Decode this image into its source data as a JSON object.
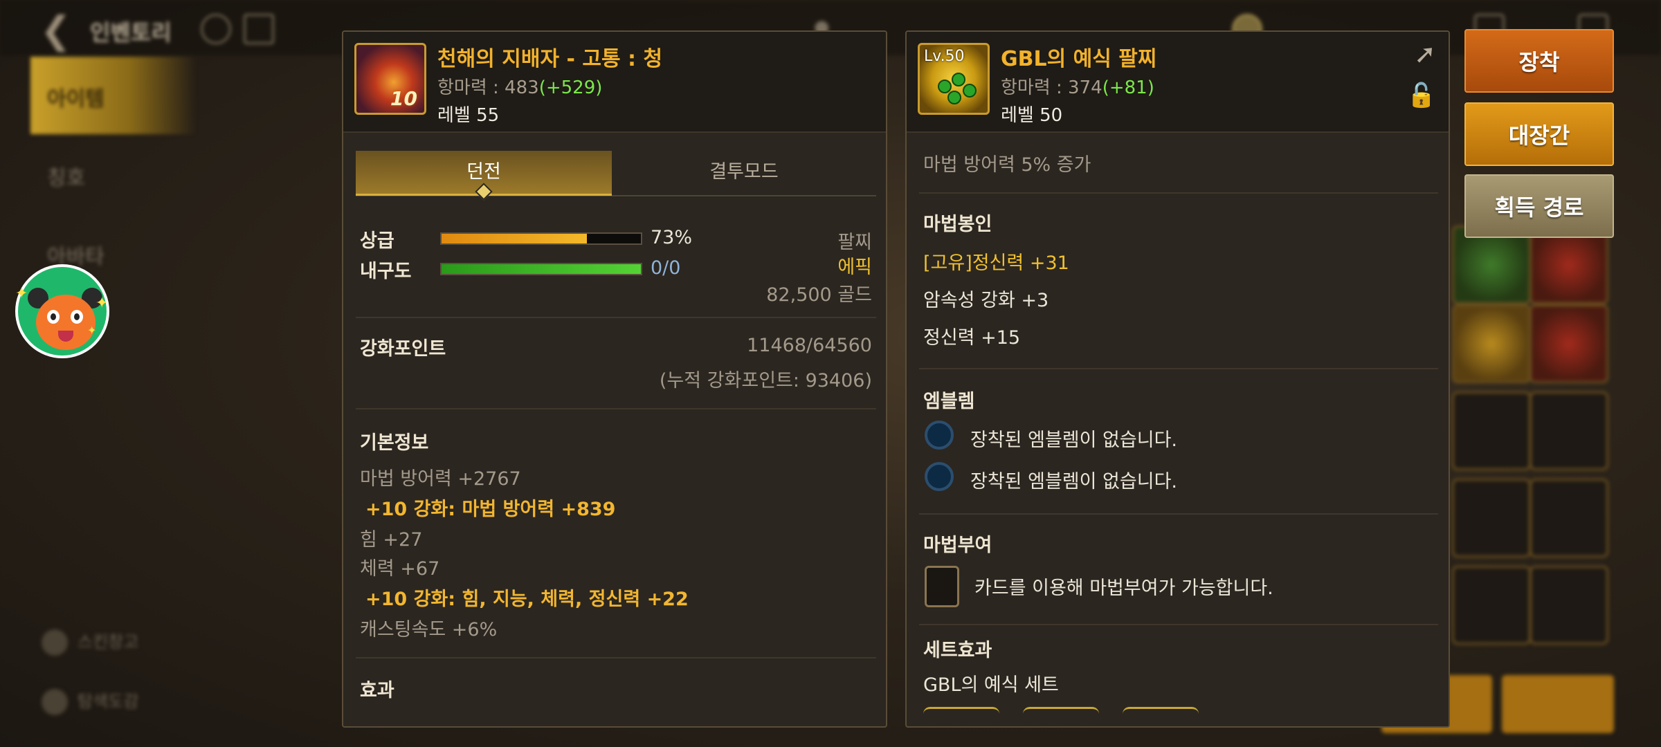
{
  "background": {
    "title": "인벤토리",
    "sidebar": [
      "아이템",
      "칭호",
      "아바타"
    ],
    "bottom_menu": [
      "스킨창고",
      "탐색도감"
    ]
  },
  "left_panel": {
    "item_name": "천해의 지배자 - 고통 : 청",
    "stat_label": "항마력 : 483",
    "stat_bonus": "(+529)",
    "level": "레벨 55",
    "enhance_badge": "10",
    "tabs": [
      "던전",
      "결투모드"
    ],
    "grade_label": "상급",
    "grade_percent": "73%",
    "grade_value": 0.73,
    "slot_type": "팔찌",
    "durability_label": "내구도",
    "durability_value": "0/0",
    "durability_fill": 1.0,
    "rarity": "에픽",
    "price": "82,500 골드",
    "enhance_points_label": "강화포인트",
    "enhance_points_value": "11468/64560",
    "enhance_points_total": "(누적 강화포인트: 93406)",
    "basic_info_title": "기본정보",
    "basic_info": [
      {
        "text": "마법 방어력 +2767",
        "style": "normal"
      },
      {
        "text": "+10 강화: 마법 방어력 +839",
        "style": "gold"
      },
      {
        "text": "힘 +27",
        "style": "normal"
      },
      {
        "text": "체력 +67",
        "style": "normal"
      },
      {
        "text": "+10 강화: 힘, 지능, 체력, 정신력 +22",
        "style": "gold"
      },
      {
        "text": "캐스팅속도 +6%",
        "style": "normal"
      }
    ],
    "effect_title": "효과"
  },
  "right_panel": {
    "icon_level": "Lv.50",
    "item_name": "GBL의 예식 팔찌",
    "stat_label": "항마력 : 374",
    "stat_bonus": "(+81)",
    "level": "레벨 50",
    "description": "마법 방어력 5% 증가",
    "magic_seal_title": "마법봉인",
    "magic_seal": [
      {
        "text": "[고유]정신력 +31",
        "style": "yellow"
      },
      {
        "text": "암속성 강화 +3",
        "style": "white"
      },
      {
        "text": "정신력 +15",
        "style": "white"
      }
    ],
    "emblem_title": "엠블렘",
    "emblems": [
      "장착된 엠블렘이 없습니다.",
      "장착된 엠블렘이 없습니다."
    ],
    "enchant_title": "마법부여",
    "enchant_text": "카드를 이용해 마법부여가 가능합니다.",
    "set_title": "세트효과",
    "set_name": "GBL의 예식 세트"
  },
  "buttons": {
    "equip": "장착",
    "blacksmith": "대장간",
    "acquire_route": "획득 경로"
  },
  "colors": {
    "accent_gold": "#f2b22c",
    "bonus_green": "#7be84a",
    "equip_btn": "#c45e14",
    "smith_btn": "#d08a14",
    "route_btn": "#95875f"
  }
}
